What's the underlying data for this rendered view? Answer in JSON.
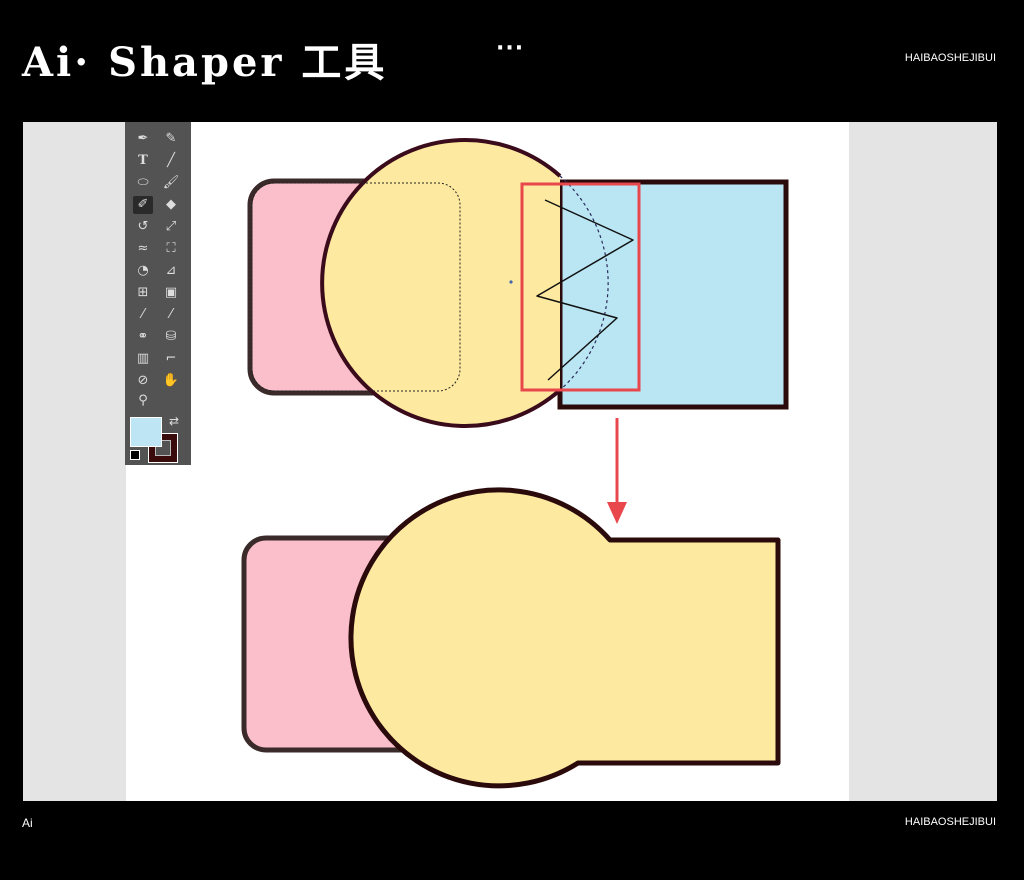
{
  "header": {
    "title": "Ai· Shaper 工具",
    "menu_dots": "···",
    "brand": "HAIBAOSHEJIBUI"
  },
  "footer": {
    "left": "Ai",
    "right": "HAIBAOSHEJIBUI"
  },
  "toolbar": {
    "tools": [
      {
        "icon": "pen-icon"
      },
      {
        "icon": "curvature-icon"
      },
      {
        "icon": "type-icon",
        "glyph": "T"
      },
      {
        "icon": "line-icon"
      },
      {
        "icon": "ellipse-icon"
      },
      {
        "icon": "paintbrush-icon"
      },
      {
        "icon": "shaper-icon",
        "selected": true
      },
      {
        "icon": "eraser-icon"
      },
      {
        "icon": "rotate-icon"
      },
      {
        "icon": "scale-icon"
      },
      {
        "icon": "warp-icon"
      },
      {
        "icon": "free-transform-icon"
      },
      {
        "icon": "shape-builder-icon"
      },
      {
        "icon": "perspective-grid-icon"
      },
      {
        "icon": "mesh-icon"
      },
      {
        "icon": "gradient-icon"
      },
      {
        "icon": "eyedropper-icon"
      },
      {
        "icon": "measure-icon"
      },
      {
        "icon": "blend-icon"
      },
      {
        "icon": "symbol-sprayer-icon"
      },
      {
        "icon": "column-graph-icon"
      },
      {
        "icon": "artboard-icon"
      },
      {
        "icon": "slice-icon"
      },
      {
        "icon": "hand-icon"
      },
      {
        "icon": "zoom-icon"
      }
    ],
    "fill_color": "#bde5f3",
    "stroke_color": "#3a0b0b"
  },
  "colors": {
    "pink": "#fbbfcb",
    "yellow": "#fdeaa0",
    "blue": "#bae6f4",
    "stroke": "#2a0a0a",
    "highlight": "#e8474c"
  }
}
